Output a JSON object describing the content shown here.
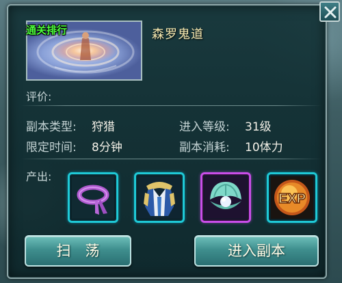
{
  "stage": {
    "ranking_tag": "通关排行",
    "name": "森罗鬼道",
    "evaluation_label": "评价:"
  },
  "info": {
    "type_label": "副本类型:",
    "type_value": "狩猎",
    "level_label": "进入等级:",
    "level_value": "31级",
    "time_label": "限定时间:",
    "time_value": "8分钟",
    "cost_label": "副本消耗:",
    "cost_value": "10体力"
  },
  "output": {
    "label": "产出:",
    "items": [
      {
        "icon": "purple-headband-icon",
        "rarity_color": "#1fc9d6"
      },
      {
        "icon": "blue-armor-icon",
        "rarity_color": "#1fc9d6"
      },
      {
        "icon": "pearl-shell-icon",
        "rarity_color": "#c94ee8"
      },
      {
        "icon": "exp-orb-icon",
        "rarity_color": "#1fc9d6",
        "text": "EXP"
      }
    ]
  },
  "buttons": {
    "sweep": "扫　荡",
    "enter": "进入副本"
  }
}
